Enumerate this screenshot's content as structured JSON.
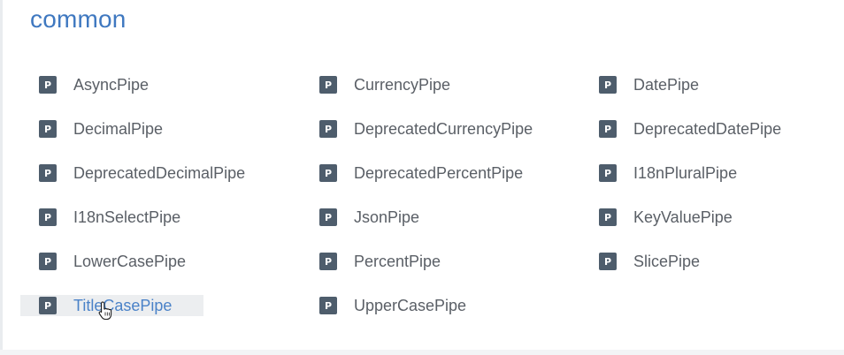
{
  "section": {
    "title": "common"
  },
  "colors": {
    "title": "#3f78c0",
    "badge": "#4e5d6c",
    "text": "#5a5f66",
    "link_hover": "#4a82c8"
  },
  "badge_letter": "P",
  "pipes": [
    {
      "label": "AsyncPipe"
    },
    {
      "label": "CurrencyPipe"
    },
    {
      "label": "DatePipe"
    },
    {
      "label": "DecimalPipe"
    },
    {
      "label": "DeprecatedCurrencyPipe"
    },
    {
      "label": "DeprecatedDatePipe"
    },
    {
      "label": "DeprecatedDecimalPipe"
    },
    {
      "label": "DeprecatedPercentPipe"
    },
    {
      "label": "I18nPluralPipe"
    },
    {
      "label": "I18nSelectPipe"
    },
    {
      "label": "JsonPipe"
    },
    {
      "label": "KeyValuePipe"
    },
    {
      "label": "LowerCasePipe"
    },
    {
      "label": "PercentPipe"
    },
    {
      "label": "SlicePipe"
    },
    {
      "label": "TitleCasePipe",
      "hovered": true
    },
    {
      "label": "UpperCasePipe"
    }
  ]
}
